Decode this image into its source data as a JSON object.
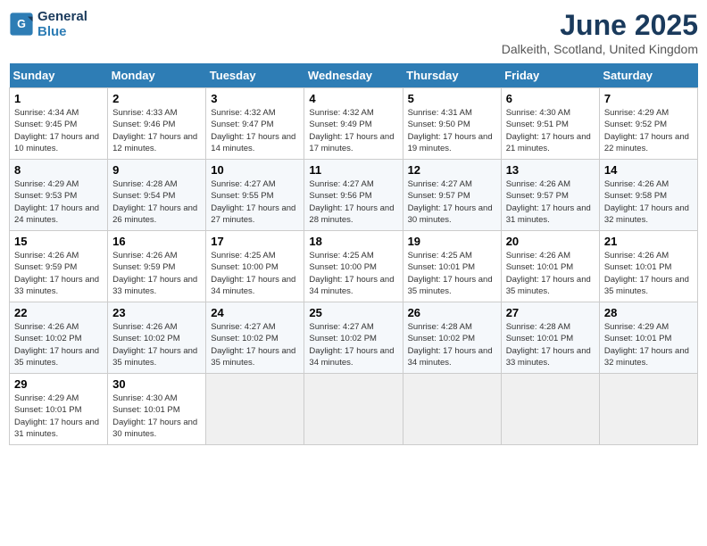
{
  "header": {
    "logo_line1": "General",
    "logo_line2": "Blue",
    "month": "June 2025",
    "location": "Dalkeith, Scotland, United Kingdom"
  },
  "days_of_week": [
    "Sunday",
    "Monday",
    "Tuesday",
    "Wednesday",
    "Thursday",
    "Friday",
    "Saturday"
  ],
  "weeks": [
    [
      {
        "num": "1",
        "sr": "4:34 AM",
        "ss": "9:45 PM",
        "dl": "17 hours and 10 minutes."
      },
      {
        "num": "2",
        "sr": "4:33 AM",
        "ss": "9:46 PM",
        "dl": "17 hours and 12 minutes."
      },
      {
        "num": "3",
        "sr": "4:32 AM",
        "ss": "9:47 PM",
        "dl": "17 hours and 14 minutes."
      },
      {
        "num": "4",
        "sr": "4:32 AM",
        "ss": "9:49 PM",
        "dl": "17 hours and 17 minutes."
      },
      {
        "num": "5",
        "sr": "4:31 AM",
        "ss": "9:50 PM",
        "dl": "17 hours and 19 minutes."
      },
      {
        "num": "6",
        "sr": "4:30 AM",
        "ss": "9:51 PM",
        "dl": "17 hours and 21 minutes."
      },
      {
        "num": "7",
        "sr": "4:29 AM",
        "ss": "9:52 PM",
        "dl": "17 hours and 22 minutes."
      }
    ],
    [
      {
        "num": "8",
        "sr": "4:29 AM",
        "ss": "9:53 PM",
        "dl": "17 hours and 24 minutes."
      },
      {
        "num": "9",
        "sr": "4:28 AM",
        "ss": "9:54 PM",
        "dl": "17 hours and 26 minutes."
      },
      {
        "num": "10",
        "sr": "4:27 AM",
        "ss": "9:55 PM",
        "dl": "17 hours and 27 minutes."
      },
      {
        "num": "11",
        "sr": "4:27 AM",
        "ss": "9:56 PM",
        "dl": "17 hours and 28 minutes."
      },
      {
        "num": "12",
        "sr": "4:27 AM",
        "ss": "9:57 PM",
        "dl": "17 hours and 30 minutes."
      },
      {
        "num": "13",
        "sr": "4:26 AM",
        "ss": "9:57 PM",
        "dl": "17 hours and 31 minutes."
      },
      {
        "num": "14",
        "sr": "4:26 AM",
        "ss": "9:58 PM",
        "dl": "17 hours and 32 minutes."
      }
    ],
    [
      {
        "num": "15",
        "sr": "4:26 AM",
        "ss": "9:59 PM",
        "dl": "17 hours and 33 minutes."
      },
      {
        "num": "16",
        "sr": "4:26 AM",
        "ss": "9:59 PM",
        "dl": "17 hours and 33 minutes."
      },
      {
        "num": "17",
        "sr": "4:25 AM",
        "ss": "10:00 PM",
        "dl": "17 hours and 34 minutes."
      },
      {
        "num": "18",
        "sr": "4:25 AM",
        "ss": "10:00 PM",
        "dl": "17 hours and 34 minutes."
      },
      {
        "num": "19",
        "sr": "4:25 AM",
        "ss": "10:01 PM",
        "dl": "17 hours and 35 minutes."
      },
      {
        "num": "20",
        "sr": "4:26 AM",
        "ss": "10:01 PM",
        "dl": "17 hours and 35 minutes."
      },
      {
        "num": "21",
        "sr": "4:26 AM",
        "ss": "10:01 PM",
        "dl": "17 hours and 35 minutes."
      }
    ],
    [
      {
        "num": "22",
        "sr": "4:26 AM",
        "ss": "10:02 PM",
        "dl": "17 hours and 35 minutes."
      },
      {
        "num": "23",
        "sr": "4:26 AM",
        "ss": "10:02 PM",
        "dl": "17 hours and 35 minutes."
      },
      {
        "num": "24",
        "sr": "4:27 AM",
        "ss": "10:02 PM",
        "dl": "17 hours and 35 minutes."
      },
      {
        "num": "25",
        "sr": "4:27 AM",
        "ss": "10:02 PM",
        "dl": "17 hours and 34 minutes."
      },
      {
        "num": "26",
        "sr": "4:28 AM",
        "ss": "10:02 PM",
        "dl": "17 hours and 34 minutes."
      },
      {
        "num": "27",
        "sr": "4:28 AM",
        "ss": "10:01 PM",
        "dl": "17 hours and 33 minutes."
      },
      {
        "num": "28",
        "sr": "4:29 AM",
        "ss": "10:01 PM",
        "dl": "17 hours and 32 minutes."
      }
    ],
    [
      {
        "num": "29",
        "sr": "4:29 AM",
        "ss": "10:01 PM",
        "dl": "17 hours and 31 minutes."
      },
      {
        "num": "30",
        "sr": "4:30 AM",
        "ss": "10:01 PM",
        "dl": "17 hours and 30 minutes."
      },
      null,
      null,
      null,
      null,
      null
    ]
  ]
}
